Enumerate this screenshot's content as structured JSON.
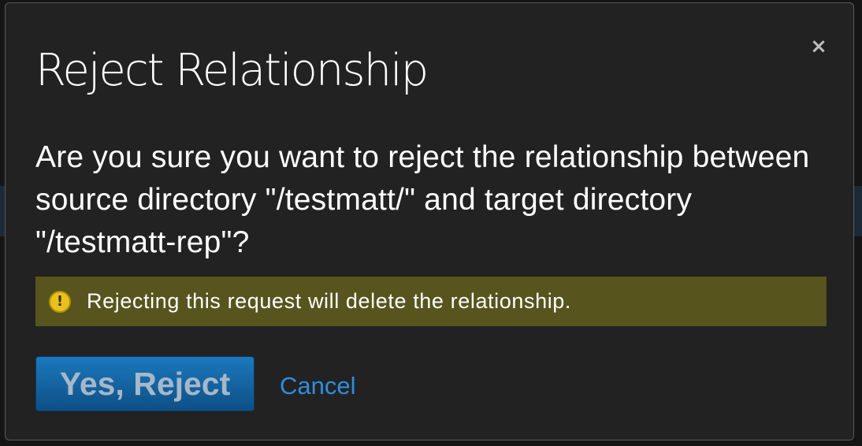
{
  "dialog": {
    "title": "Reject Relationship",
    "close_symbol": "×",
    "question": "Are you sure you want to reject the relationship between source directory \"/testmatt/\" and target directory \"/testmatt-rep\"?",
    "warning": {
      "icon": "exclamation-icon",
      "icon_glyph": "!",
      "text": "Rejecting this request will delete the relationship."
    },
    "buttons": {
      "confirm_label": "Yes, Reject",
      "cancel_label": "Cancel"
    }
  },
  "colors": {
    "modal_bg": "#222222",
    "warning_bg": "#57541e",
    "warning_icon": "#e8c21b",
    "primary_button": "#1b79bd",
    "link": "#2d8ee0"
  }
}
